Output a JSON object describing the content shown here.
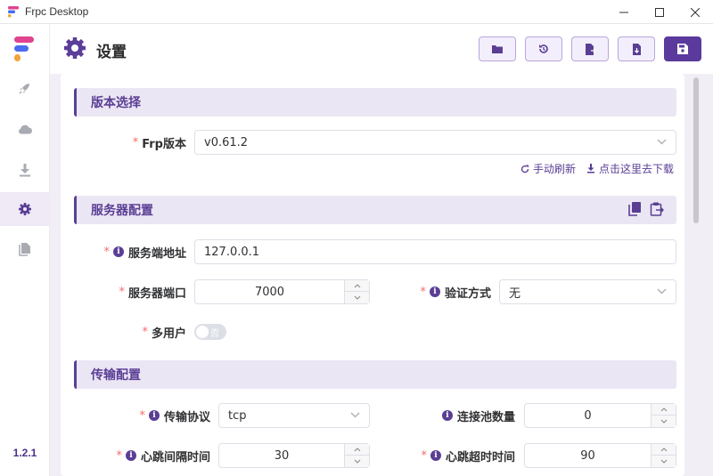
{
  "window": {
    "title": "Frpc Desktop"
  },
  "app": {
    "version": "1.2.1",
    "accent": "#5a3e94"
  },
  "header": {
    "title": "设置"
  },
  "toolbar": [
    "folder-icon",
    "history-icon",
    "file-export-icon",
    "file-import-icon",
    "save-icon"
  ],
  "sidebar": [
    "rocket-icon",
    "cloud-icon",
    "download-icon",
    "gear-icon",
    "file-icon"
  ],
  "version_section": {
    "title": "版本选择",
    "frp_version_label": "Frp版本",
    "frp_version_value": "v0.61.2",
    "refresh_link": "手动刷新",
    "download_link": "点击这里去下载"
  },
  "server_section": {
    "title": "服务器配置",
    "address_label": "服务端地址",
    "address_value": "127.0.0.1",
    "port_label": "服务器端口",
    "port_value": "7000",
    "auth_label": "验证方式",
    "auth_value": "无",
    "multiuser_label": "多用户",
    "multiuser_state": "否"
  },
  "transport_section": {
    "title": "传输配置",
    "protocol_label": "传输协议",
    "protocol_value": "tcp",
    "pool_label": "连接池数量",
    "pool_value": "0",
    "heartbeat_interval_label": "心跳间隔时间",
    "heartbeat_interval_value": "30",
    "heartbeat_timeout_label": "心跳超时时间",
    "heartbeat_timeout_value": "90"
  }
}
